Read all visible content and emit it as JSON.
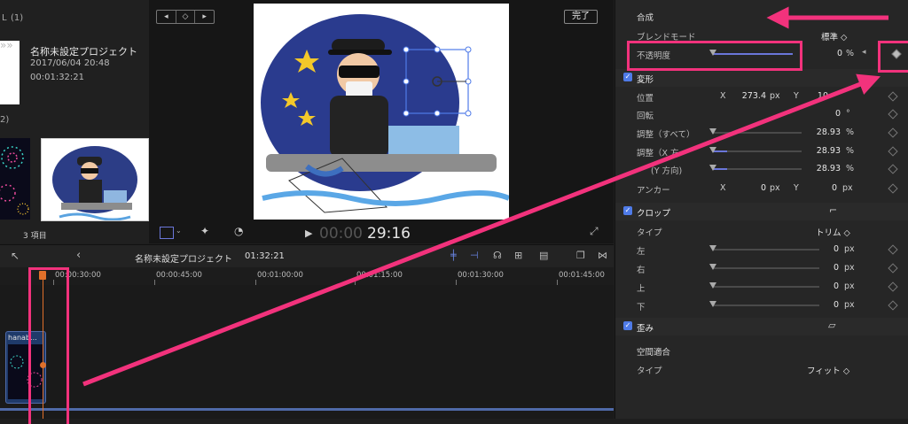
{
  "browser": {
    "header_count": "(1)",
    "header_prefix": "L",
    "project_name": "名称未設定プロジェクト",
    "project_date": "2017/06/04 20:48",
    "project_duration": "00:01:32:21",
    "section2_count": "2)",
    "item_count": "3 項目"
  },
  "viewer": {
    "done_label": "完了",
    "timecode_dim": "00:00",
    "timecode": "29:16"
  },
  "timeline": {
    "project_name": "名称未設定プロジェクト",
    "duration": "01:32:21",
    "clip_label": "hanab...",
    "ruler_ticks": [
      "00:00:30:00",
      "00:00:45:00",
      "00:01:00:00",
      "00:01:15:00",
      "00:01:30:00",
      "00:01:45:00"
    ]
  },
  "inspector": {
    "composite_title": "合成",
    "blend_mode_label": "ブレンドモード",
    "blend_mode_value": "標準 ◇",
    "opacity_label": "不透明度",
    "opacity_value": "0",
    "opacity_unit": "%",
    "transform_title": "変形",
    "position_label": "位置",
    "position_x_axis": "X",
    "position_x_value": "273.4",
    "position_x_unit": "px",
    "position_y_axis": "Y",
    "position_y_value": "10",
    "rotation_label": "回転",
    "rotation_value": "0",
    "rotation_unit": "°",
    "scale_all_label": "調整（すべて）",
    "scale_all_value": "28.93",
    "scale_x_label": "調整（X 方",
    "scale_x_value": "28.93",
    "scale_y_label": "(Y 方向)",
    "scale_y_value": "28.93",
    "percent": "%",
    "anchor_label": "アンカー",
    "anchor_x_axis": "X",
    "anchor_x_value": "0",
    "anchor_y_axis": "Y",
    "anchor_y_value": "0",
    "px": "px",
    "crop_title": "クロップ",
    "crop_type_label": "タイプ",
    "crop_type_value": "トリム ◇",
    "crop_left_label": "左",
    "crop_right_label": "右",
    "crop_top_label": "上",
    "crop_bottom_label": "下",
    "crop_zero": "0",
    "distort_title": "歪み",
    "spatial_title": "空間適合",
    "spatial_type_label": "タイプ",
    "spatial_type_value": "フィット ◇"
  },
  "colors": {
    "accent": "#f2327c",
    "blue": "#4f7be8",
    "playhead": "#e0702a"
  }
}
